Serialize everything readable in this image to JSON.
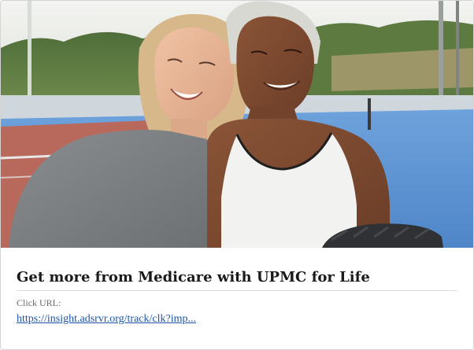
{
  "ad": {
    "headline": "Get more from Medicare with UPMC for Life",
    "click_url_label": "Click URL:",
    "click_url": "https://insight.adsrvr.org/track/clk?imp..."
  },
  "colors": {
    "link": "#1a55a8",
    "headline": "#1a1a1a",
    "court_blue": "#5f97d6",
    "court_red": "#b66a5e"
  }
}
